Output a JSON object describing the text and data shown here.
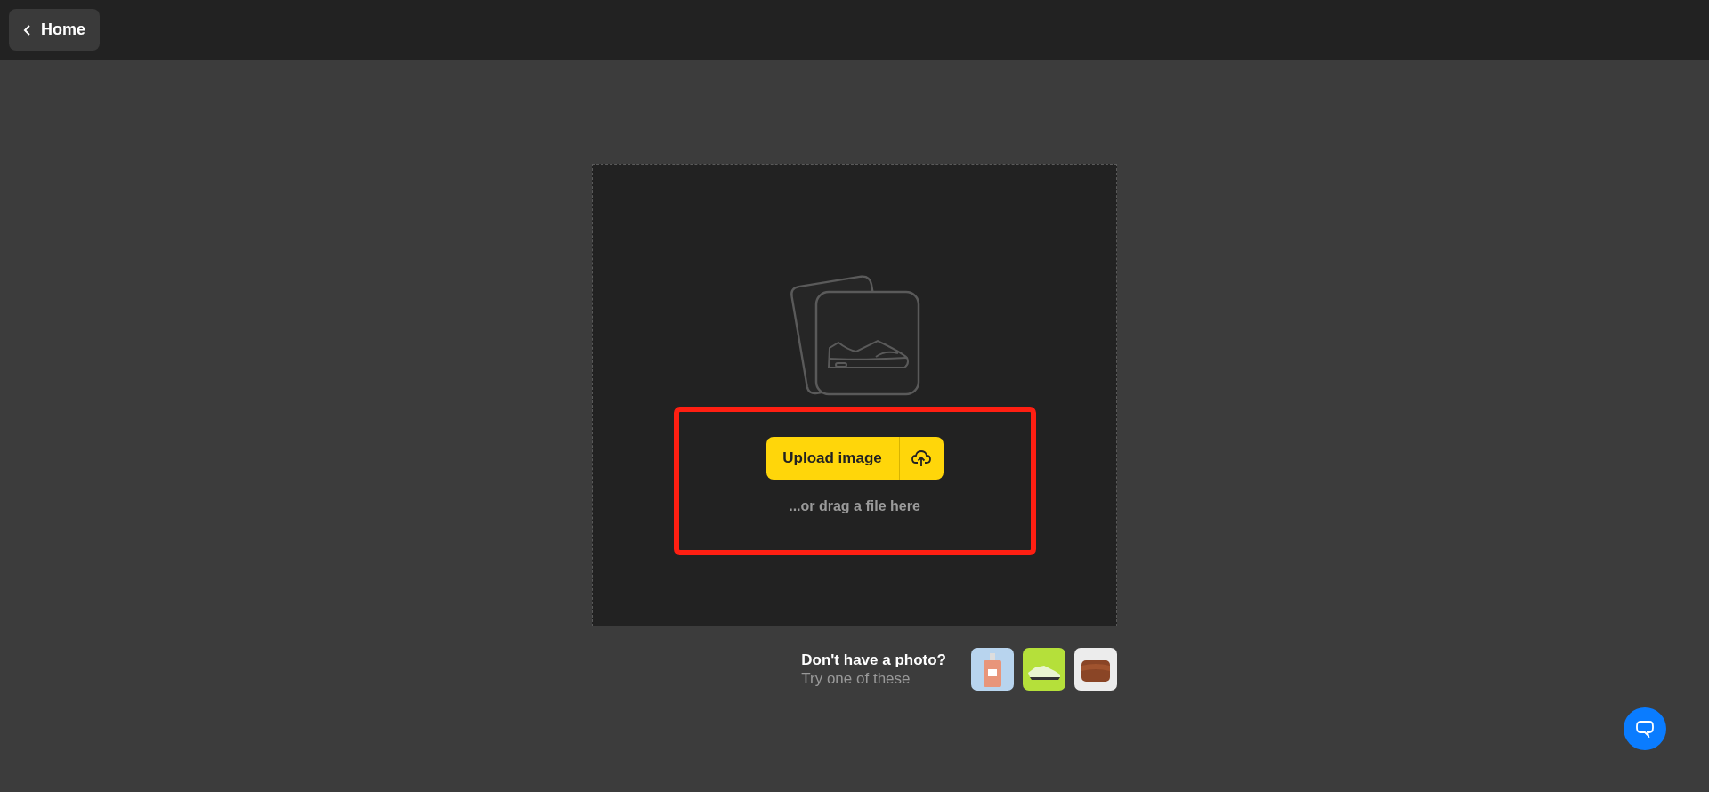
{
  "top_bar": {
    "back_button": {
      "label": "Home"
    }
  },
  "drop_zone": {
    "upload_button": {
      "label": "Upload image"
    },
    "drag_hint": "...or drag a file here",
    "highlighted": true
  },
  "samples": {
    "title": "Don't have a photo?",
    "subtitle": "Try one of these",
    "images": [
      {
        "kind": "bottle"
      },
      {
        "kind": "sneaker"
      },
      {
        "kind": "bag"
      }
    ]
  }
}
